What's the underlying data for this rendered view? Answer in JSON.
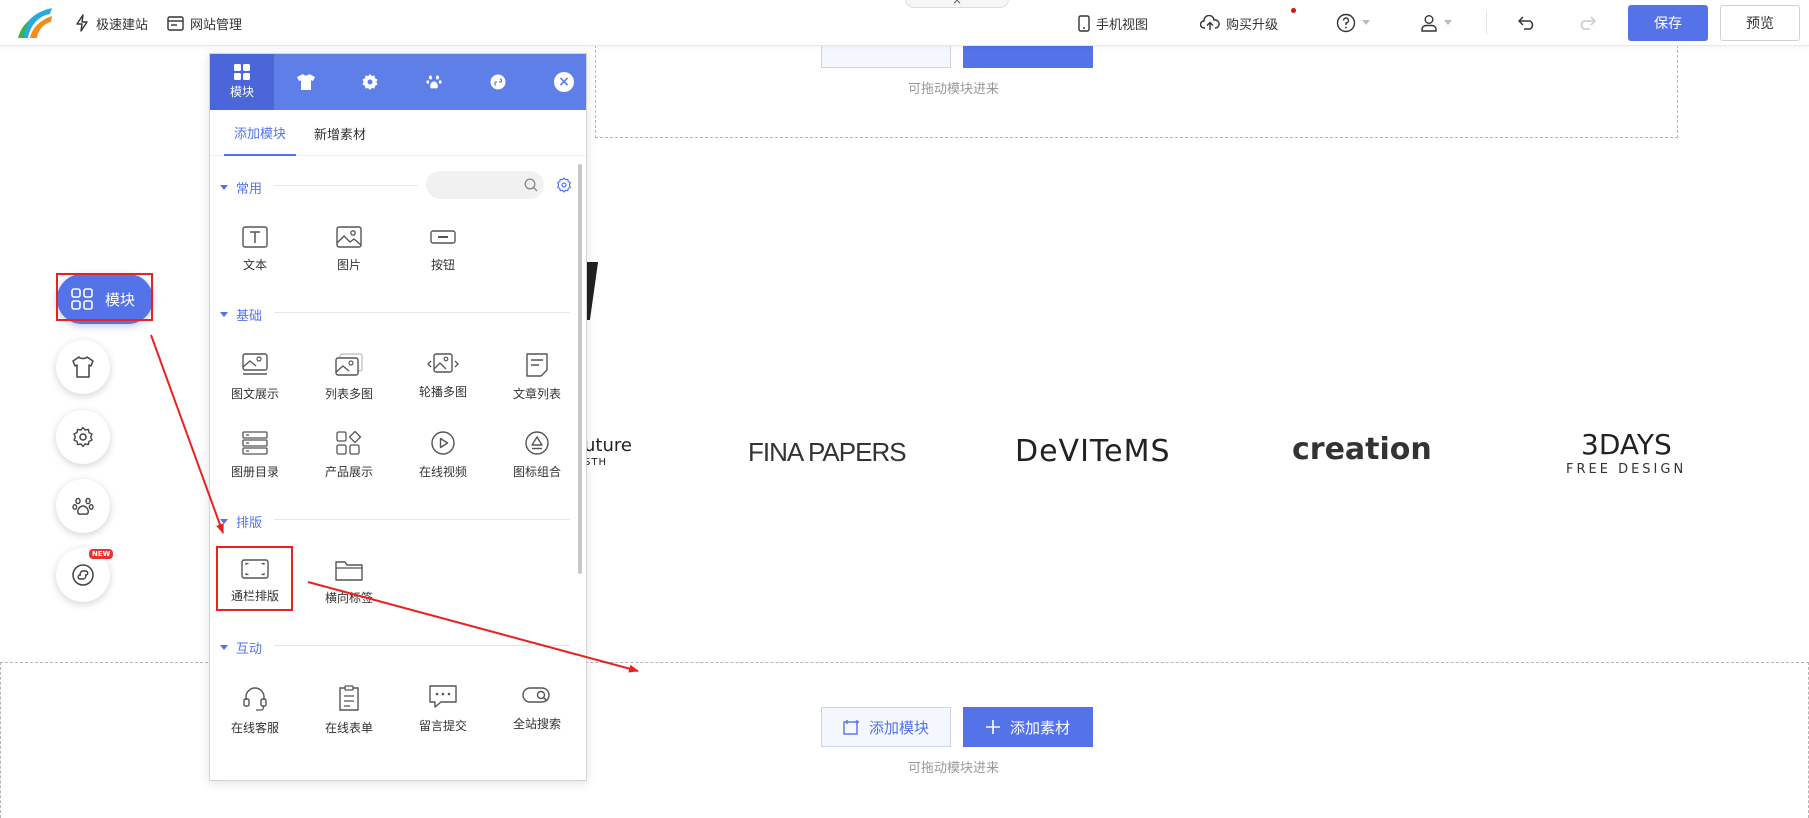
{
  "topbar": {
    "quick_build": "极速建站",
    "site_manage": "网站管理",
    "mobile_view": "手机视图",
    "buy_upgrade": "购买升级",
    "save": "保存",
    "preview": "预览",
    "close_glyph": "×"
  },
  "canvas": {
    "drop_hint_top": "可拖动模块进来",
    "drop_hint_bottom": "可拖动模块进来",
    "add_module": "添加模块",
    "add_material": "添加素材",
    "brands": {
      "future": "uture",
      "future_sub": "STH",
      "fina": "FINA PAPERS",
      "devitems": "DeVITeMS",
      "creation": "creation",
      "threedays": "3DAYS",
      "threedays_sub": "FREE DESIGN"
    }
  },
  "left_toolbar": {
    "module_label": "模块",
    "new_badge": "NEW"
  },
  "panel": {
    "active_tab_label": "模块",
    "subtabs": [
      "添加模块",
      "新增素材"
    ],
    "sections": {
      "common": {
        "title": "常用",
        "items": [
          "文本",
          "图片",
          "按钮"
        ]
      },
      "basic": {
        "title": "基础",
        "items": [
          "图文展示",
          "列表多图",
          "轮播多图",
          "文章列表",
          "图册目录",
          "产品展示",
          "在线视频",
          "图标组合"
        ]
      },
      "layout": {
        "title": "排版",
        "items": [
          "通栏排版",
          "横向标签"
        ]
      },
      "interact": {
        "title": "互动",
        "items": [
          "在线客服",
          "在线表单",
          "留言提交",
          "全站搜索"
        ]
      }
    }
  },
  "colors": {
    "accent": "#5473e8",
    "panel_header": "#5f7fe8",
    "annotation": "#e8231f"
  }
}
